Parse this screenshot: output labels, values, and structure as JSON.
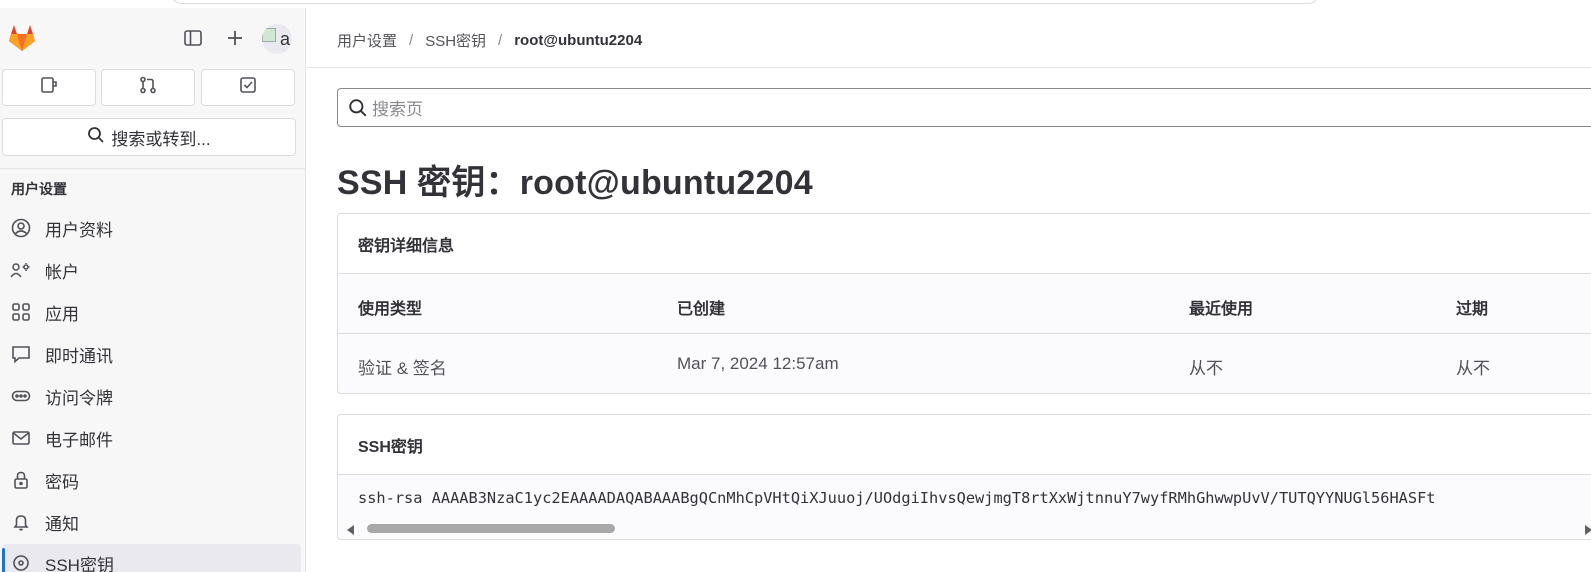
{
  "sidebar": {
    "logo_icon": "gitlab-tanuki-icon",
    "top_icons": [
      "sidebar-toggle-icon",
      "plus-icon"
    ],
    "avatar_text": "a",
    "quick_actions": [
      "issues-icon",
      "merge-requests-icon",
      "todo-icon"
    ],
    "search_label": "搜索或转到...",
    "section_title": "用户设置",
    "items": [
      {
        "label": "用户资料",
        "icon": "user-circle-icon"
      },
      {
        "label": "帐户",
        "icon": "account-gear-icon"
      },
      {
        "label": "应用",
        "icon": "applications-icon"
      },
      {
        "label": "即时通讯",
        "icon": "chat-icon"
      },
      {
        "label": "访问令牌",
        "icon": "token-icon"
      },
      {
        "label": "电子邮件",
        "icon": "mail-icon"
      },
      {
        "label": "密码",
        "icon": "lock-icon"
      },
      {
        "label": "通知",
        "icon": "bell-icon"
      },
      {
        "label": "SSH密钥",
        "icon": "key-icon"
      }
    ]
  },
  "breadcrumb": {
    "items": [
      "用户设置",
      "SSH密钥"
    ],
    "current": "root@ubuntu2204"
  },
  "page_search": {
    "placeholder": "搜索页"
  },
  "page_title": "SSH 密钥：root@ubuntu2204",
  "details_card": {
    "title": "密钥详细信息",
    "headers": [
      "使用类型",
      "已创建",
      "最近使用",
      "过期"
    ],
    "row": [
      "验证 & 签名",
      "Mar 7, 2024 12:57am",
      "从不",
      "从不"
    ]
  },
  "key_card": {
    "title": "SSH密钥",
    "key": "ssh-rsa AAAAB3NzaC1yc2EAAAADAQABAAABgQCnMhCpVHtQiXJuuoj/UOdgiIhvsQewjmgT8rtXxWjtnnuY7wyfRMhGhwwpUvV/TUTQYYNUGl56HASFt"
  },
  "colors": {
    "accent": "#1f75cb",
    "sidebar_bg": "#f7f7f8",
    "text": "#333238"
  }
}
